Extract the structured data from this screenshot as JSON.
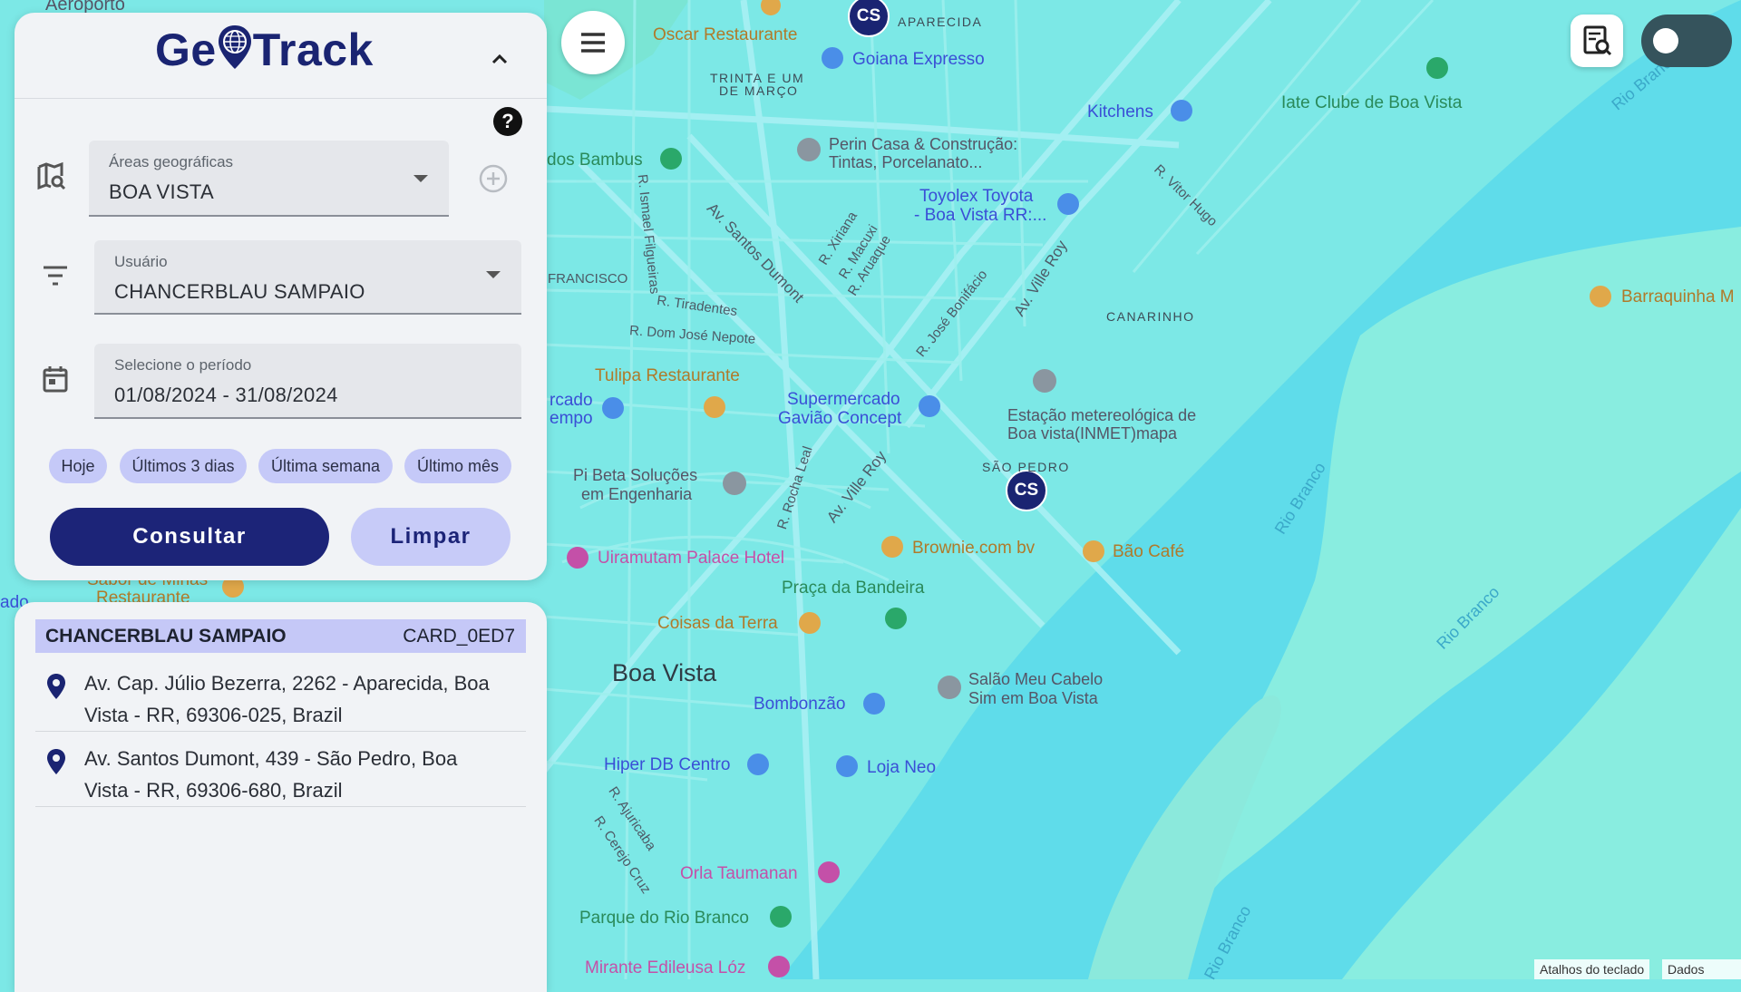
{
  "app": {
    "logo_text_left": "Ge",
    "logo_text_right": "Track"
  },
  "filters": {
    "area": {
      "label": "Áreas geográficas",
      "value": "BOA VISTA"
    },
    "user": {
      "label": "Usuário",
      "value": "CHANCERBLAU SAMPAIO"
    },
    "period": {
      "label": "Selecione o período",
      "value": "01/08/2024 - 31/08/2024"
    },
    "help_icon": "?",
    "quick_ranges": [
      "Hoje",
      "Últimos 3 dias",
      "Última semana",
      "Último mês"
    ],
    "consult_label": "Consultar",
    "clear_label": "Limpar"
  },
  "results": {
    "user": "CHANCERBLAU SAMPAIO",
    "card": "CARD_0ED7",
    "addresses": [
      "Av. Cap. Júlio Bezerra, 2262 - Aparecida, Boa Vista - RR, 69306-025, Brazil",
      "Av. Santos Dumont, 439 - São Pedro, Boa Vista - RR, 69306-680, Brazil"
    ]
  },
  "map": {
    "markers": [
      "CS",
      "CS"
    ],
    "labels": {
      "aeroporto": "Aeroporto",
      "oscar": "Oscar Restaurante",
      "aparecida": "APARECIDA",
      "goiana": "Goiana Expresso",
      "trinta_1": "TRINTA E UM",
      "trinta_2": "DE MARÇO",
      "kitchens": "Kitchens",
      "iate": "Iate Clube de Boa Vista",
      "bambus": "dos Bambus",
      "perin_1": "Perin Casa & Construção:",
      "perin_2": "Tintas, Porcelanato...",
      "toyolex_1": "Toyolex Toyota",
      "toyolex_2": "- Boa Vista RR:...",
      "francisco": "FRANCISCO",
      "tiradentes": "R. Tiradentes",
      "dom_jose": "R. Dom José Nepote",
      "canarinho": "CANARINHO",
      "barraquinha": "Barraquinha M",
      "tulipa": "Tulipa Restaurante",
      "mercado_1": "rcado",
      "mercado_2": "empo",
      "super_1": "Supermercado",
      "super_2": "Gavião Concept",
      "estacao_1": "Estação metereológica de",
      "estacao_2": "Boa vista(INMET)mapa",
      "sao_pedro": "SÃO PEDRO",
      "pibeta_1": "Pi Beta Soluções",
      "pibeta_2": "em Engenharia",
      "uiramutam": "Uiramutam Palace Hotel",
      "brownie": "Brownie.com bv",
      "bao": "Bão Café",
      "praca": "Praça da Bandeira",
      "coisas": "Coisas da Terra",
      "boa_vista": "Boa Vista",
      "salao_1": "Salão Meu Cabelo",
      "salao_2": "Sim em Boa Vista",
      "bombonzao": "Bombonzão",
      "hiper": "Hiper DB Centro",
      "loja": "Loja Neo",
      "orla": "Orla Taumanan",
      "parque": "Parque do Rio Branco",
      "mirante": "Mirante Edileusa Lóz",
      "sabor_1": "Sabor de Minas",
      "sabor_2": "Restaurante",
      "ado": "ado",
      "rio_branco": "Rio Branco",
      "av_santos": "Av. Santos Dumont",
      "av_ville": "Av. Ville Roy",
      "r_ismael": "R. Ismael Filgueiras",
      "r_xiriana": "R. Xiriana",
      "r_macuxi": "R. Macuxi",
      "r_aruaque": "R. Aruaque",
      "r_jose": "R. José Bonifácio",
      "r_vitor": "R. Vitor Hugo",
      "r_rocha": "R. Rocha Leal",
      "r_ajuricaba": "R. Ajuricaba",
      "r_cerejo": "R. Cerejo Cruz"
    },
    "attribution": [
      "Atalhos do teclado",
      "Dados carto"
    ]
  }
}
